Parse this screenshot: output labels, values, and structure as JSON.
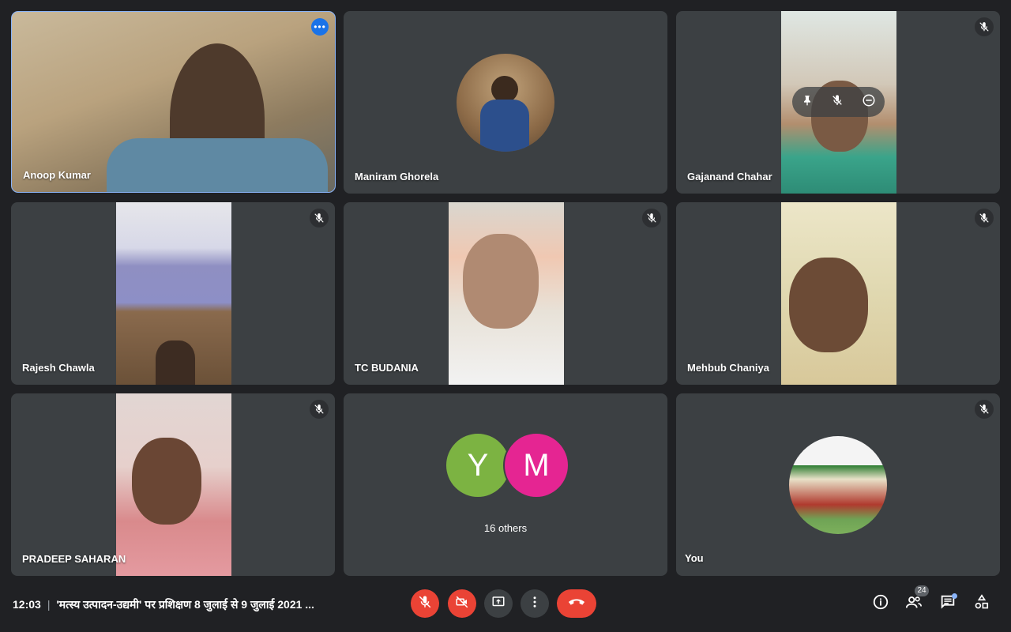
{
  "participants": [
    {
      "name": "Anoop Kumar"
    },
    {
      "name": "Maniram Ghorela"
    },
    {
      "name": "Gajanand Chahar"
    },
    {
      "name": "Rajesh Chawla"
    },
    {
      "name": "TC BUDANIA"
    },
    {
      "name": "Mehbub Chaniya"
    },
    {
      "name": "PRADEEP SAHARAN"
    },
    {
      "name": "You"
    }
  ],
  "others": {
    "avatars": [
      {
        "letter": "Y",
        "color": "#7cb342"
      },
      {
        "letter": "M",
        "color": "#e52592"
      }
    ],
    "label": "16 others"
  },
  "tile_menu_icon": "more-horiz-icon",
  "bottom_bar": {
    "time": "12:03",
    "separator": "|",
    "meeting_title": "'मत्स्य उत्पादन-उद्यमी' पर प्रशिक्षण 8 जुलाई से 9 जुलाई 2021 ...",
    "controls": [
      "mic-off-icon",
      "camera-off-icon",
      "present-icon",
      "more-vert-icon",
      "end-call-icon"
    ],
    "right_icons": [
      "info-icon",
      "people-icon",
      "chat-icon",
      "activities-icon"
    ],
    "people_count": "24"
  },
  "colors": {
    "background": "#202124",
    "tile": "#3c4043",
    "danger": "#ea4335",
    "active_outline": "#8ab4f8"
  }
}
